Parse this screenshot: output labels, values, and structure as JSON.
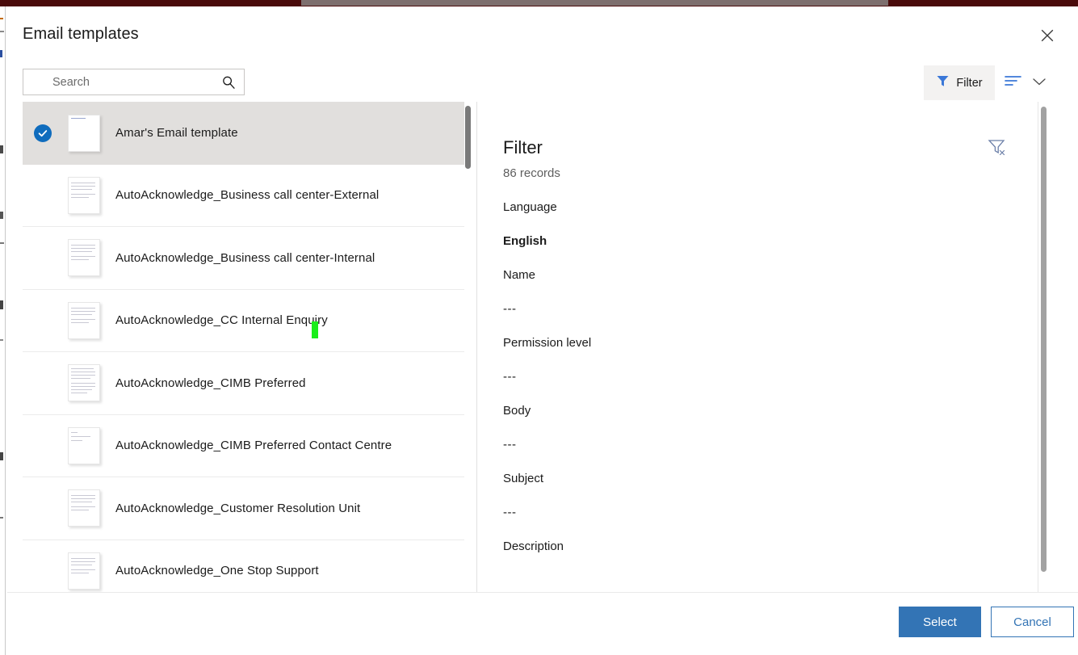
{
  "window": {
    "chrome_color": "#4a0b0b",
    "chrome_segment_color": "#7d6f6e"
  },
  "dialog": {
    "title": "Email templates",
    "close_icon": "close-icon"
  },
  "search": {
    "placeholder": "Search",
    "value": "",
    "icon": "search-icon"
  },
  "commandbar": {
    "filter_label": "Filter",
    "filter_icon": "funnel-icon",
    "sort_icon": "sort-lines-icon",
    "chevron_icon": "chevron-down-icon",
    "accent": "#3b78d8"
  },
  "list": {
    "scrollbar": "list-vertical-scrollbar",
    "items": [
      {
        "label": "Amar's Email template",
        "selected": true,
        "thumb": "document-thumbnail-blank"
      },
      {
        "label": "AutoAcknowledge_Business call center-External",
        "selected": false,
        "thumb": "document-thumbnail-lines"
      },
      {
        "label": "AutoAcknowledge_Business call center-Internal",
        "selected": false,
        "thumb": "document-thumbnail-lines"
      },
      {
        "label": "AutoAcknowledge_CC Internal Enquiry",
        "selected": false,
        "thumb": "document-thumbnail-lines"
      },
      {
        "label": "AutoAcknowledge_CIMB Preferred",
        "selected": false,
        "thumb": "document-thumbnail-dense"
      },
      {
        "label": "AutoAcknowledge_CIMB Preferred Contact Centre",
        "selected": false,
        "thumb": "document-thumbnail-sparse"
      },
      {
        "label": "AutoAcknowledge_Customer Resolution Unit",
        "selected": false,
        "thumb": "document-thumbnail-lines"
      },
      {
        "label": "AutoAcknowledge_One Stop Support",
        "selected": false,
        "thumb": "document-thumbnail-lines"
      }
    ]
  },
  "detail": {
    "title": "Filter",
    "record_count": "86 records",
    "clear_filter_icon": "clear-filter-icon",
    "fields": [
      {
        "label": "Language",
        "value": "English",
        "bold": true
      },
      {
        "label": "Name",
        "value": "---",
        "bold": false
      },
      {
        "label": "Permission level",
        "value": "---",
        "bold": false
      },
      {
        "label": "Body",
        "value": "---",
        "bold": false
      },
      {
        "label": "Subject",
        "value": "---",
        "bold": false
      },
      {
        "label": "Description",
        "value": "",
        "bold": false
      }
    ]
  },
  "footer": {
    "select_label": "Select",
    "cancel_label": "Cancel",
    "primary_color": "#3374b5"
  },
  "cursor": {
    "marker_color": "#1aee1a"
  }
}
